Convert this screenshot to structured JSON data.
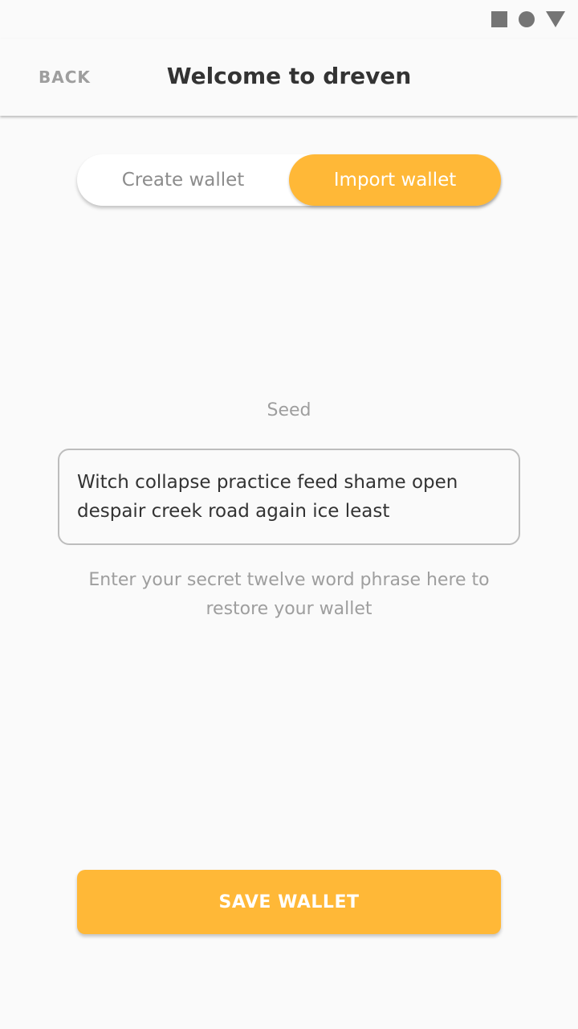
{
  "status_bar": {
    "icons": [
      "square-icon",
      "circle-icon",
      "triangle-icon"
    ]
  },
  "app_bar": {
    "back_label": "BACK",
    "title": "Welcome to dreven"
  },
  "wallet_toggle": {
    "create_label": "Create wallet",
    "import_label": "Import wallet",
    "selected": "Import wallet"
  },
  "seed": {
    "label": "Seed",
    "value": "Witch collapse practice feed shame open despair creek road again ice least",
    "hint": "Enter your secret twelve word phrase here to restore your wallet"
  },
  "save_button": {
    "label": "SAVE WALLET"
  },
  "colors": {
    "accent": "#ffb837",
    "background": "#fafafa",
    "text_dark": "#333333",
    "text_muted": "#9e9e9e"
  }
}
